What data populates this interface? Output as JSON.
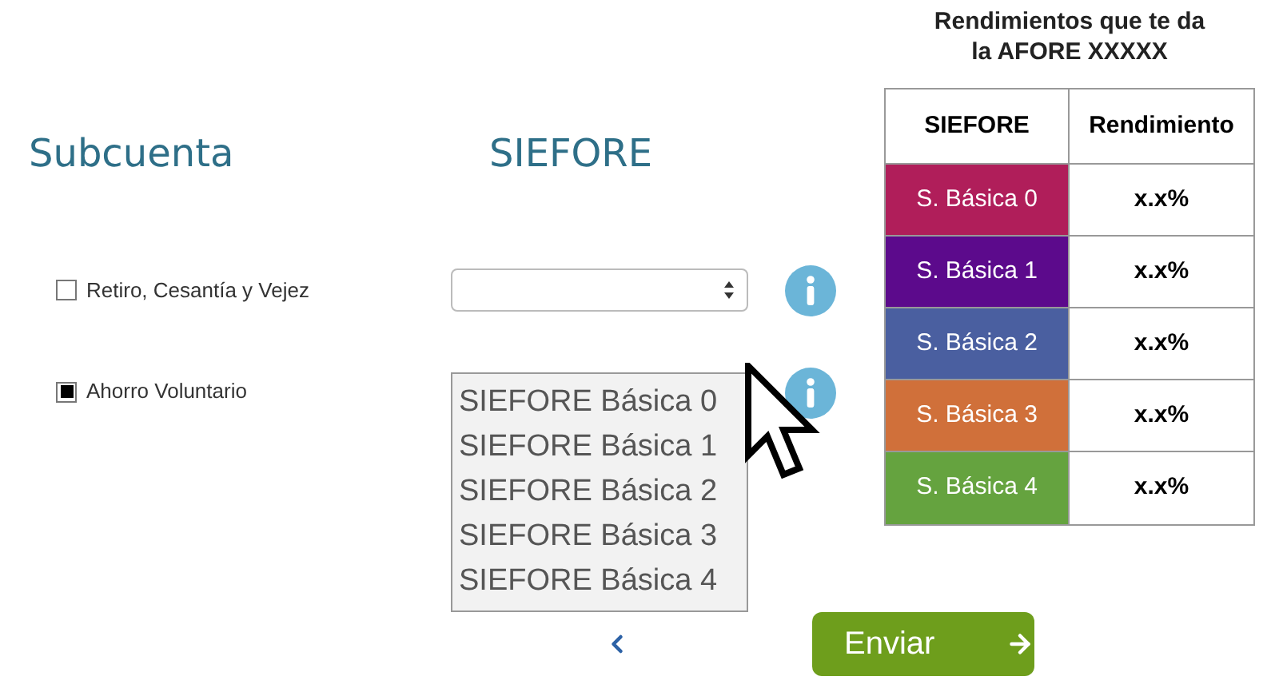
{
  "headings": {
    "subcuenta": "Subcuenta",
    "siefore": "SIEFORE"
  },
  "subcuentas": [
    {
      "label": "Retiro, Cesantía y Vejez",
      "checked": false,
      "kind": "select"
    },
    {
      "label": "Ahorro Voluntario",
      "checked": true,
      "kind": "listbox",
      "options": [
        {
          "label": "SIEFORE Básica 0",
          "selected": false
        },
        {
          "label": "SIEFORE Básica 1",
          "selected": false
        },
        {
          "label": "SIEFORE Básica 2",
          "selected": false
        },
        {
          "label": "SIEFORE Básica 3",
          "selected": false
        },
        {
          "label": "SIEFORE Básica 4",
          "selected": false
        }
      ]
    }
  ],
  "submit_button": {
    "label": "Enviar"
  },
  "returns_table": {
    "title": "Rendimientos que te da la AFORE XXXXX",
    "columns": [
      "SIEFORE",
      "Rendimiento"
    ],
    "rows": [
      {
        "siefore": "S. Básica 0",
        "color": "#b01e5a",
        "rendimiento": "x.x%"
      },
      {
        "siefore": "S. Básica 1",
        "color": "#5c0a8c",
        "rendimiento": "x.x%"
      },
      {
        "siefore": "S. Básica 2",
        "color": "#4a5fa0",
        "rendimiento": "x.x%"
      },
      {
        "siefore": "S. Básica 3",
        "color": "#d0703a",
        "rendimiento": "x.x%"
      },
      {
        "siefore": "S. Básica 4",
        "color": "#65a33f",
        "rendimiento": "x.x%"
      }
    ]
  }
}
